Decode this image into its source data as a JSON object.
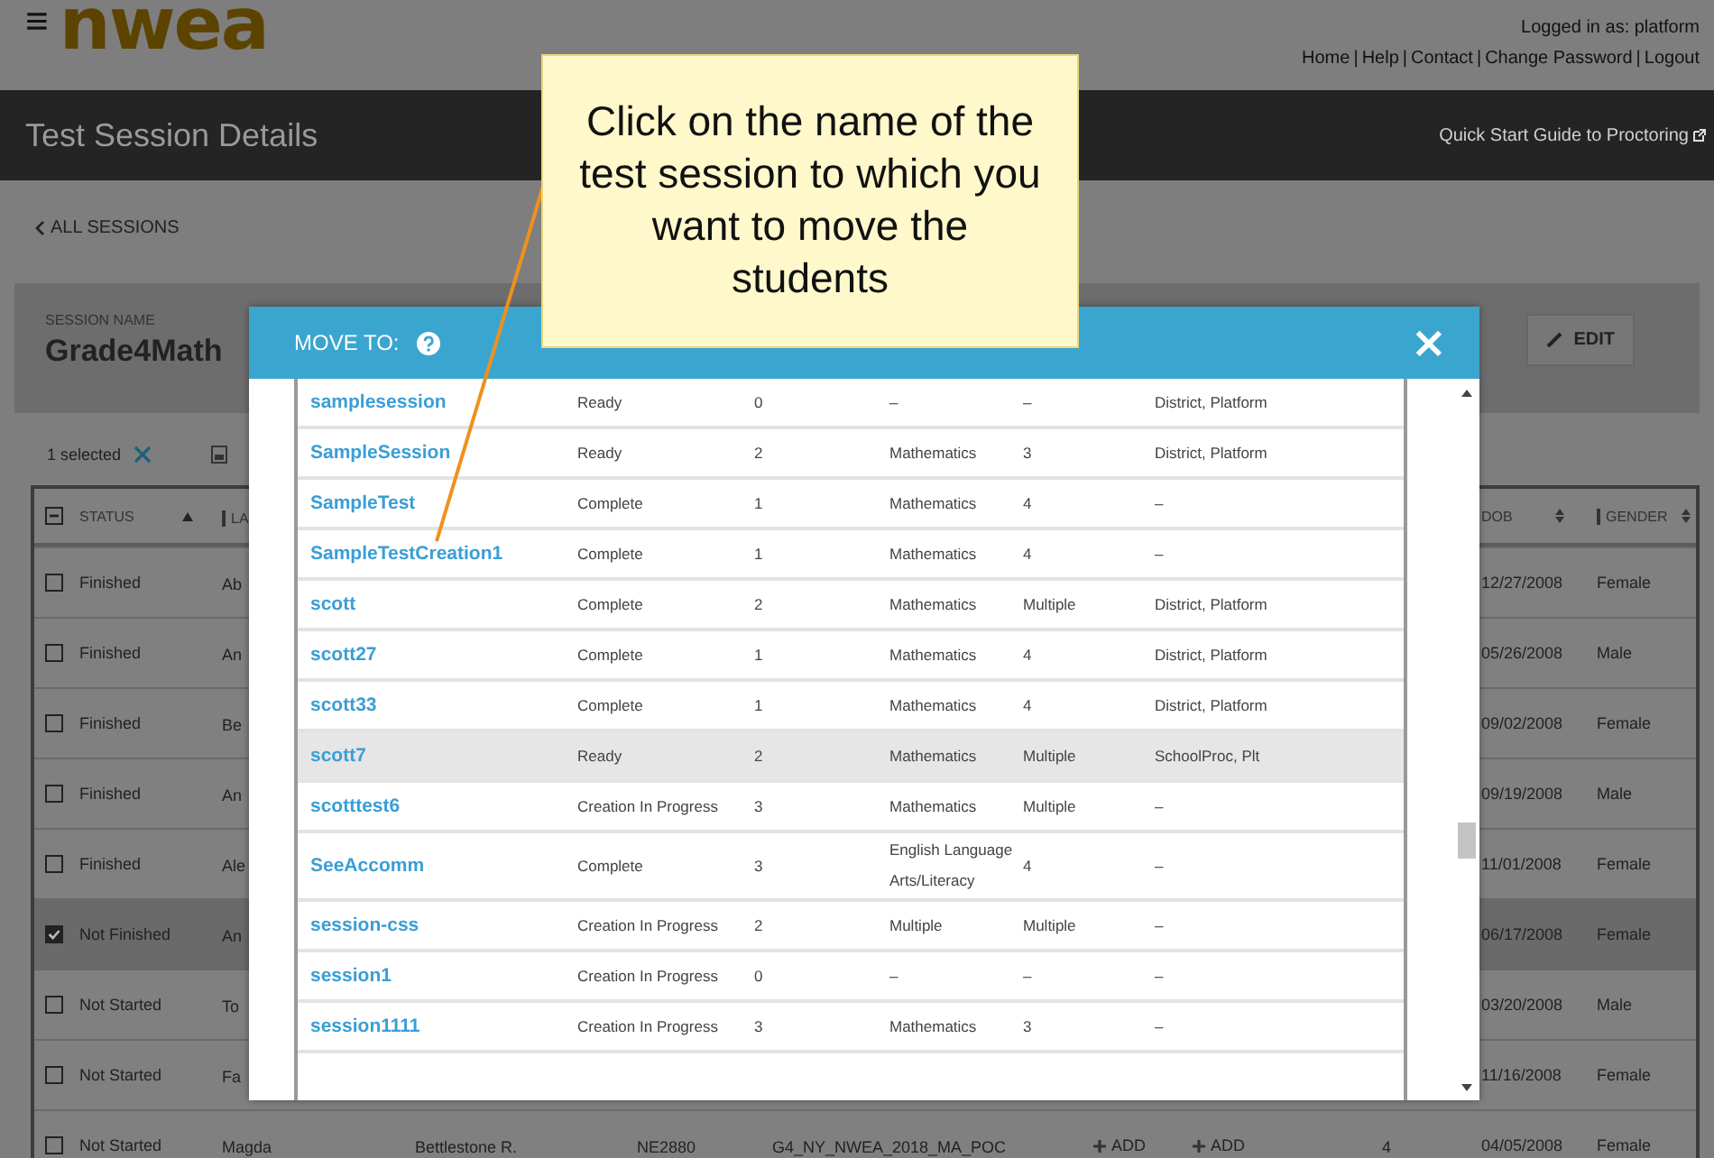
{
  "header": {
    "menu_glyph": "≡",
    "logo": "nwea",
    "logged_in": "Logged in as: platform",
    "separator": "|",
    "links": [
      "Home",
      "Help",
      "Contact",
      "Change Password",
      "Logout"
    ]
  },
  "title_bar": {
    "title": "Test Session Details",
    "guide_link": "Quick Start Guide to Proctoring"
  },
  "back_link": "ALL SESSIONS",
  "session": {
    "label": "SESSION NAME",
    "name": "Grade4Math",
    "edit_button": "EDIT"
  },
  "toolbar": {
    "selected_count": "1 selected"
  },
  "students_table": {
    "select_all_partial": true,
    "columns": [
      "STATUS",
      "LA",
      "DOB",
      "GENDER"
    ],
    "rows": [
      {
        "status": "Finished",
        "checked": false,
        "name": "Ab",
        "dob": "12/27/2008",
        "gender": "Female"
      },
      {
        "status": "Finished",
        "checked": false,
        "name": "An",
        "dob": "05/26/2008",
        "gender": "Male"
      },
      {
        "status": "Finished",
        "checked": false,
        "name": "Be",
        "dob": "09/02/2008",
        "gender": "Female"
      },
      {
        "status": "Finished",
        "checked": false,
        "name": "An",
        "dob": "09/19/2008",
        "gender": "Male"
      },
      {
        "status": "Finished",
        "checked": false,
        "name": "Ale",
        "dob": "11/01/2008",
        "gender": "Female"
      },
      {
        "status": "Not Finished",
        "checked": true,
        "name": "An",
        "dob": "06/17/2008",
        "gender": "Female"
      },
      {
        "status": "Not Started",
        "checked": false,
        "name": "To",
        "dob": "03/20/2008",
        "gender": "Male"
      },
      {
        "status": "Not Started",
        "checked": false,
        "name": "Fa",
        "dob": "11/16/2008",
        "gender": "Female"
      },
      {
        "status": "Not Started",
        "checked": false,
        "name": "Magda",
        "dob": "04/05/2008",
        "gender": "Female",
        "extra": [
          {
            "kind": "text",
            "text": "Bettlestone R."
          },
          {
            "kind": "text",
            "text": "NE2880"
          },
          {
            "kind": "text",
            "text": "G4_NY_NWEA_2018_MA_POC"
          },
          {
            "kind": "add",
            "text": "ADD"
          },
          {
            "kind": "add",
            "text": "ADD"
          },
          {
            "kind": "text",
            "text": "4"
          }
        ]
      }
    ]
  },
  "modal": {
    "title": "MOVE TO:",
    "close_glyph": "×",
    "rows": [
      {
        "name": "samplesession",
        "status": "Ready",
        "students": "0",
        "subject": "–",
        "grade": "–",
        "owner": "District, Platform",
        "selected": false
      },
      {
        "name": "SampleSession",
        "status": "Ready",
        "students": "2",
        "subject": "Mathematics",
        "grade": "3",
        "owner": "District, Platform",
        "selected": false
      },
      {
        "name": "SampleTest",
        "status": "Complete",
        "students": "1",
        "subject": "Mathematics",
        "grade": "4",
        "owner": "–",
        "selected": false
      },
      {
        "name": "SampleTestCreation1",
        "status": "Complete",
        "students": "1",
        "subject": "Mathematics",
        "grade": "4",
        "owner": "–",
        "selected": false
      },
      {
        "name": "scott",
        "status": "Complete",
        "students": "2",
        "subject": "Mathematics",
        "grade": "Multiple",
        "owner": "District, Platform",
        "selected": false
      },
      {
        "name": "scott27",
        "status": "Complete",
        "students": "1",
        "subject": "Mathematics",
        "grade": "4",
        "owner": "District, Platform",
        "selected": false
      },
      {
        "name": "scott33",
        "status": "Complete",
        "students": "1",
        "subject": "Mathematics",
        "grade": "4",
        "owner": "District, Platform",
        "selected": false
      },
      {
        "name": "scott7",
        "status": "Ready",
        "students": "2",
        "subject": "Mathematics",
        "grade": "Multiple",
        "owner": "SchoolProc, Plt",
        "selected": true
      },
      {
        "name": "scotttest6",
        "status": "Creation In Progress",
        "students": "3",
        "subject": "Mathematics",
        "grade": "Multiple",
        "owner": "–",
        "selected": false
      },
      {
        "name": "SeeAccomm",
        "status": "Complete",
        "students": "3",
        "subject": "English Language Arts/Literacy",
        "grade": "4",
        "owner": "–",
        "selected": false
      },
      {
        "name": "session-css",
        "status": "Creation In Progress",
        "students": "2",
        "subject": "Multiple",
        "grade": "Multiple",
        "owner": "–",
        "selected": false
      },
      {
        "name": "session1",
        "status": "Creation In Progress",
        "students": "0",
        "subject": "–",
        "grade": "–",
        "owner": "–",
        "selected": false
      },
      {
        "name": "session1111",
        "status": "Creation In Progress",
        "students": "3",
        "subject": "Mathematics",
        "grade": "3",
        "owner": "–",
        "selected": false
      }
    ]
  },
  "callout": {
    "text": "Click on the name of the test session to which you want to move the students"
  }
}
